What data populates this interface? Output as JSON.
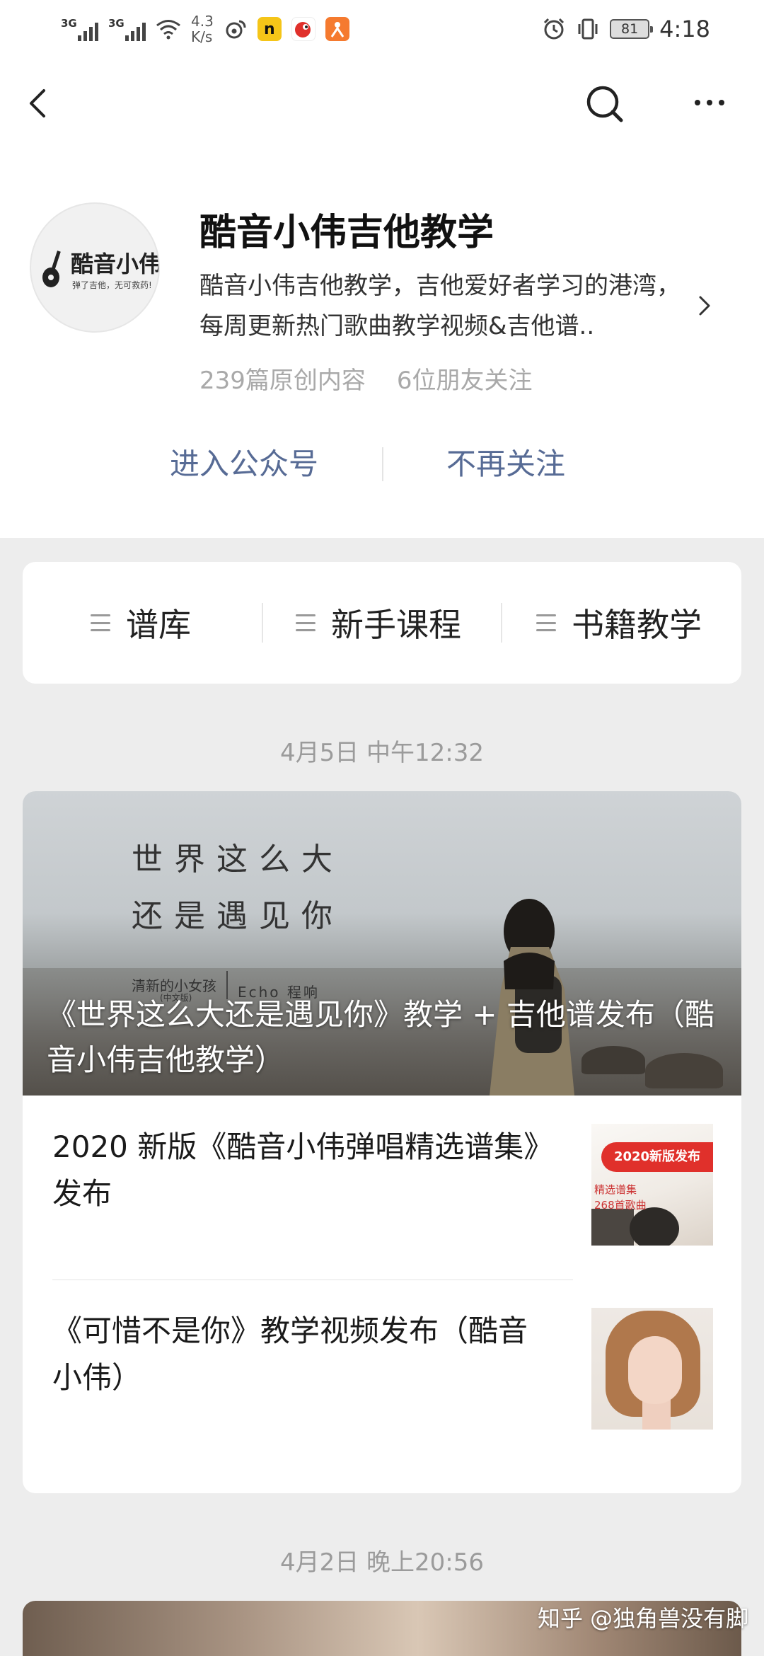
{
  "status_bar": {
    "signal1": "3G",
    "signal2": "3G",
    "speed_value": "4.3",
    "speed_unit": "K/s",
    "app_icon_2": "n",
    "battery": "81",
    "time": "4:18"
  },
  "account": {
    "name": "酷音小伟吉他教学",
    "description": "酷音小伟吉他教学，吉他爱好者学习的港湾，每周更新热门歌曲教学视频&吉他谱..",
    "original_count": "239篇原创内容",
    "friends_following": "6位朋友关注",
    "avatar_logo_text": "酷音小伟",
    "avatar_slogan": "弹了吉他，无可救药!"
  },
  "actions": {
    "enter_label": "进入公众号",
    "unfollow_label": "不再关注"
  },
  "menu": {
    "items": [
      {
        "label": "谱库"
      },
      {
        "label": "新手课程"
      },
      {
        "label": "书籍教学"
      }
    ]
  },
  "timeline": {
    "date1": "4月5日 中午12:32",
    "date2": "4月2日 晚上20:56"
  },
  "featured": {
    "hero_line1": "世界这么大",
    "hero_line2": "还是遇见你",
    "hero_caption_left": "清新的小女孩",
    "hero_caption_sub": "(中文版)",
    "hero_caption_right": "Echo 程响",
    "title": "《世界这么大还是遇见你》教学 + 吉他谱发布（酷音小伟吉他教学）"
  },
  "articles": [
    {
      "title": "2020 新版《酷音小伟弹唱精选谱集》发布",
      "thumb_tag": "2020新版发布",
      "thumb_line1": "精选谱集",
      "thumb_line2": "268首歌曲"
    },
    {
      "title": "《可惜不是你》教学视频发布（酷音小伟）"
    }
  ],
  "watermark": "知乎 @独角兽没有脚",
  "icons": {
    "back": "back-arrow-icon",
    "search": "search-icon",
    "more": "more-icon",
    "menu": "hamburger-icon",
    "chevron": "chevron-right-icon"
  },
  "colors": {
    "link": "#576b95",
    "background": "#ededed",
    "secondary_text": "#a9a9a9"
  }
}
